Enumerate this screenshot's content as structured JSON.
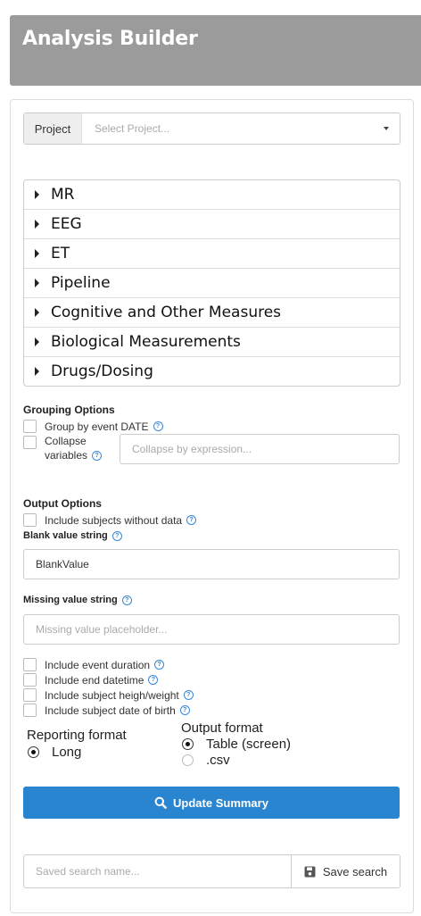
{
  "header": {
    "title": "Analysis Builder"
  },
  "project": {
    "label": "Project",
    "placeholder": "Select Project..."
  },
  "accordion": [
    "MR",
    "EEG",
    "ET",
    "Pipeline",
    "Cognitive and Other Measures",
    "Biological Measurements",
    "Drugs/Dosing"
  ],
  "grouping": {
    "title": "Grouping Options",
    "group_by_date": "Group by event DATE",
    "collapse_line1": "Collapse",
    "collapse_line2": "variables",
    "collapse_placeholder": "Collapse by expression..."
  },
  "output": {
    "title": "Output Options",
    "include_without_data": "Include subjects without data",
    "blank_label": "Blank value string",
    "blank_value": "BlankValue",
    "missing_label": "Missing value string",
    "missing_placeholder": "Missing value placeholder...",
    "event_duration": "Include event duration",
    "end_datetime": "Include end datetime",
    "height_weight": "Include subject heigh/weight",
    "dob": "Include subject date of birth"
  },
  "reporting": {
    "title": "Reporting format",
    "long": "Long"
  },
  "format": {
    "title": "Output format",
    "table": "Table (screen)",
    "csv": ".csv"
  },
  "actions": {
    "update_summary": "Update Summary",
    "saved_search_placeholder": "Saved search name...",
    "save_search": "Save search"
  },
  "icons": {
    "help": "question-circle-icon",
    "search": "search-icon",
    "save": "floppy-disk-icon"
  },
  "colors": {
    "primary": "#2a85d0",
    "header_bg": "#9b9b9b",
    "help": "#3a86d6"
  }
}
